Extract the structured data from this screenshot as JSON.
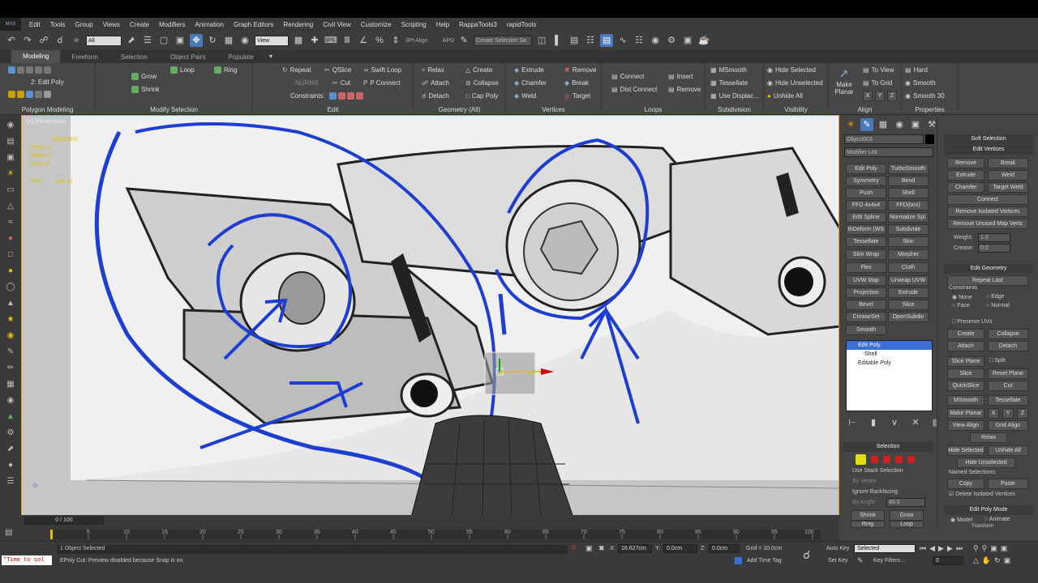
{
  "app": {
    "logo": "MAX"
  },
  "menu": [
    "Edit",
    "Tools",
    "Group",
    "Views",
    "Create",
    "Modifiers",
    "Animation",
    "Graph Editors",
    "Rendering",
    "Civil View",
    "Customize",
    "Scripting",
    "Help",
    "RappaTools3",
    "rapidTools"
  ],
  "toolbar": {
    "filter": "All",
    "ref_coord": "View",
    "snap_label": "3Pt Align",
    "apd_label": "APD",
    "selection_set": "Create Selection Se"
  },
  "ribbon_tabs": [
    "Modeling",
    "Freeform",
    "Selection",
    "Object Paint",
    "Populate"
  ],
  "ribbon": {
    "polygon_modeling": {
      "stack": "2: Edit Poly",
      "title": "Polygon Modeling"
    },
    "modify_selection": {
      "grow": "Grow",
      "shrink": "Shrink",
      "loop": "Loop",
      "ring": "Ring",
      "title": "Modify Selection"
    },
    "edit": {
      "repeat": "Repeat",
      "qslice": "QSlice",
      "swift_loop": "Swift Loop",
      "nurms": "NURMS",
      "cut": "Cut",
      "p_connect": "P Connect",
      "constraints": "Constraints:",
      "title": "Edit"
    },
    "geometry": {
      "relax": "Relax",
      "create": "Create",
      "attach": "Attach",
      "collapse": "Collapse",
      "detach": "Detach",
      "cap_poly": "Cap Poly",
      "title": "Geometry (All)"
    },
    "vertices": {
      "extrude": "Extrude",
      "remove": "Remove",
      "chamfer": "Chamfer",
      "break": "Break",
      "weld": "Weld",
      "target": "Target",
      "title": "Vertices"
    },
    "loops": {
      "connect": "Connect",
      "insert": "Insert",
      "dist_connect": "Dist Connect",
      "remove": "Remove",
      "title": "Loops"
    },
    "subdivision": {
      "msmooth": "MSmooth",
      "tessellate": "Tessellate",
      "use_displac": "Use Displac...",
      "title": "Subdivision"
    },
    "visibility": {
      "hide_selected": "Hide Selected",
      "hide_unselected": "Hide Unselected",
      "unhide_all": "Unhide All",
      "title": "Visibility"
    },
    "align": {
      "make_planar": "Make Planar",
      "to_view": "To View",
      "to_grid": "To Grid",
      "x": "X",
      "y": "Y",
      "z": "Z",
      "title": "Align"
    },
    "properties": {
      "hard": "Hard",
      "smooth": "Smooth",
      "smooth30": "Smooth 30",
      "title": "Properties"
    }
  },
  "viewport": {
    "label": "[+] [Perspective",
    "stats_object": "Object003",
    "polys": "Polys:",
    "polys_val": "0",
    "edges": "Edges:",
    "edges_val": "0",
    "verts": "Verts:",
    "verts_val": "4",
    "fps": "FPS:",
    "fps_val": "136.41"
  },
  "command_panel": {
    "object_name": "Object003",
    "modifier_list": "Modifier List",
    "modifiers": [
      "Edit Poly",
      "TurboSmooth",
      "Symmetry",
      "Bend",
      "Push",
      "Shell",
      "FFD 4x4x4",
      "FFD(box)",
      "Edit Spline",
      "Normalize Spl.",
      "thDeform (WS",
      "Subdivide",
      "Tessellate",
      "Skin",
      "Skin Wrap",
      "Morpher",
      "Flex",
      "Cloth",
      "UVW Map",
      "Unwrap UVW",
      "Projection",
      "Extrude",
      "Bevel",
      "Slice",
      "CreaseSet",
      "OpenSubdiv",
      "Smooth"
    ],
    "stack": [
      "Edit Poly",
      "Shell",
      "Editable Poly"
    ],
    "selection": {
      "title": "Selection",
      "use_stack": "Use Stack Selection",
      "by_vertex": "By Vertex",
      "ignore_backfacing": "Ignore Backfacing",
      "by_angle": "By Angle:",
      "angle_val": "45.0",
      "shrink": "Shrink",
      "grow": "Grow",
      "ring": "Ring",
      "loop": "Loop"
    }
  },
  "rollout": {
    "soft_selection": "Soft Selection",
    "edit_vertices": "Edit Vertices",
    "remove": "Remove",
    "break": "Break",
    "extrude": "Extrude",
    "weld": "Weld",
    "chamfer": "Chamfer",
    "target_weld": "Target Weld",
    "connect": "Connect",
    "remove_isolated": "Remove Isolated Vertices",
    "remove_unused": "Remove Unused Map Verts",
    "weight": "Weight:",
    "weight_val": "1.0",
    "crease": "Crease:",
    "crease_val": "0.0",
    "edit_geometry": "Edit Geometry",
    "repeat_last": "Repeat Last",
    "constraints": "Constraints",
    "none": "None",
    "edge": "Edge",
    "face": "Face",
    "normal": "Normal",
    "preserve_uvs": "Preserve UVs",
    "create": "Create",
    "collapse": "Collapse",
    "attach": "Attach",
    "detach": "Detach",
    "slice_plane": "Slice Plane",
    "split": "Split",
    "slice": "Slice",
    "reset_plane": "Reset Plane",
    "quickslice": "QuickSlice",
    "cut": "Cut",
    "msmooth": "MSmooth",
    "tessellate": "Tessellate",
    "make_planar": "Make Planar",
    "x": "X",
    "y": "Y",
    "z": "Z",
    "view_align": "View Align",
    "grid_align": "Grid Align",
    "relax": "Relax",
    "hide_selected": "Hide Selected",
    "unhide_all": "Unhide All",
    "hide_unselected": "Hide Unselected",
    "named_selections": "Named Selections:",
    "copy": "Copy",
    "paste": "Paste",
    "delete_isolated": "Delete Isolated Vertices",
    "edit_poly_mode": "Edit Poly Mode",
    "model": "Model",
    "animate": "Animate",
    "transform": "Transform"
  },
  "timeline": {
    "frame": "0 / 100",
    "ticks": [
      "5",
      "10",
      "15",
      "20",
      "25",
      "30",
      "35",
      "40",
      "45",
      "50",
      "55",
      "60",
      "65",
      "70",
      "75",
      "80",
      "85",
      "90",
      "95",
      "100"
    ]
  },
  "status": {
    "maxscript": "\"Time to sol",
    "selected": "1 Object Selected",
    "prompt": "EPoly Cut: Preview disabled because Snap is on.",
    "x_label": "X:",
    "x_val": "16.627cm",
    "y_label": "Y:",
    "y_val": "0.0cm",
    "z_label": "Z:",
    "z_val": "0.0cm",
    "grid": "Grid = 10.0cm",
    "add_time_tag": "Add Time Tag",
    "auto_key": "Auto Key",
    "auto_key_val": "Selected",
    "set_key": "Set Key",
    "key_filters": "Key Filters...",
    "frame_val": "0"
  }
}
